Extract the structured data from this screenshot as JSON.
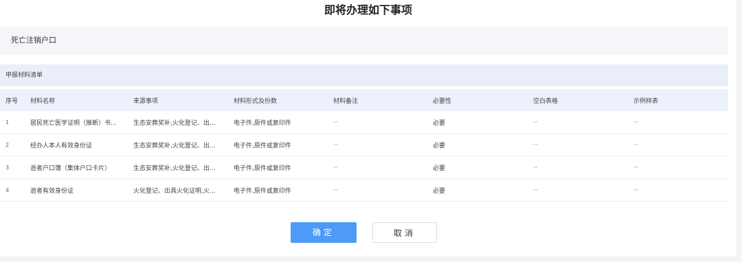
{
  "dialog": {
    "title": "即将办理如下事项",
    "item_name": "死亡注销户口",
    "section_title": "申报材料清单"
  },
  "table": {
    "headers": [
      "序号",
      "材料名称",
      "来源事项",
      "材料形式及份数",
      "材料备注",
      "必要性",
      "空白表格",
      "示例样表"
    ],
    "rows": [
      [
        "1",
        "居民死亡医学证明（推断）书...",
        "生态安葬奖补,火化登记、出...",
        "电子件,原件或复印件",
        "--",
        "必要",
        "--",
        "--"
      ],
      [
        "2",
        "经办人本人有效身份证",
        "生态安葬奖补,火化登记、出...",
        "电子件,原件或复印件",
        "--",
        "必要",
        "--",
        "--"
      ],
      [
        "3",
        "逝者户口簿（集体户口卡片）",
        "生态安葬奖补,火化登记、出...",
        "电子件,原件或复印件",
        "--",
        "必要",
        "--",
        "--"
      ],
      [
        "4",
        "逝者有效身份证",
        "火化登记、出具火化证明,火...",
        "电子件,原件或复印件",
        "--",
        "必要",
        "--",
        "--"
      ]
    ]
  },
  "buttons": {
    "confirm": "确定",
    "cancel": "取消"
  },
  "colors": {
    "primary": "#4d9af7",
    "table_header_bg": "#edf1fb",
    "item_bg": "#f5f6f9"
  }
}
